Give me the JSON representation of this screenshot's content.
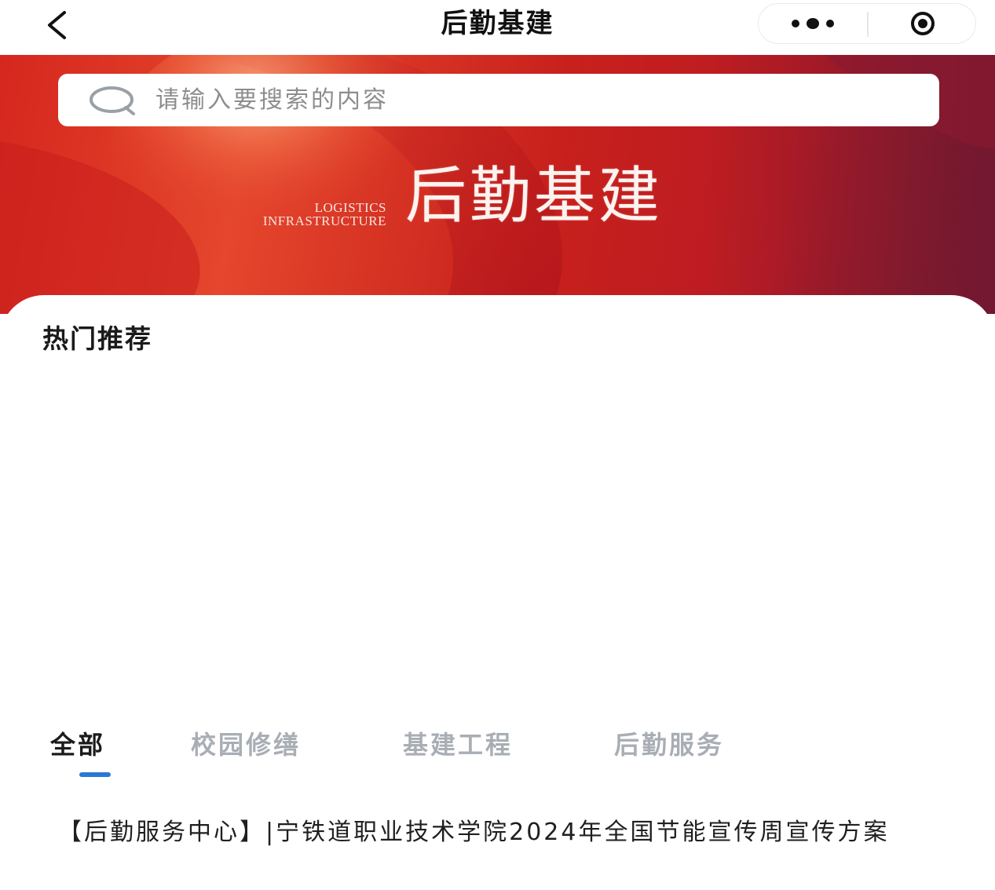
{
  "navbar": {
    "title": "后勤基建",
    "back_icon": "chevron-left-icon",
    "more_icon": "more-dots-icon",
    "close_icon": "target-close-icon"
  },
  "banner": {
    "search_placeholder": "请输入要搜索的内容",
    "en_line1": "LOGISTICS",
    "en_line2": "INFRASTRUCTURE",
    "title": "后勤基建",
    "colors": {
      "primary_red": "#d5271e",
      "dark_red": "#7d1a2e"
    }
  },
  "main": {
    "section_title": "热门推荐",
    "tabs": [
      {
        "label": "全部",
        "active": true
      },
      {
        "label": "校园修缮",
        "active": false
      },
      {
        "label": "基建工程",
        "active": false
      },
      {
        "label": "后勤服务",
        "active": false
      }
    ],
    "articles": [
      {
        "title": "【后勤服务中心】|宁铁道职业技术学院2024年全国节能宣传周宣传方案"
      }
    ],
    "accent_color": "#2a78d6"
  }
}
